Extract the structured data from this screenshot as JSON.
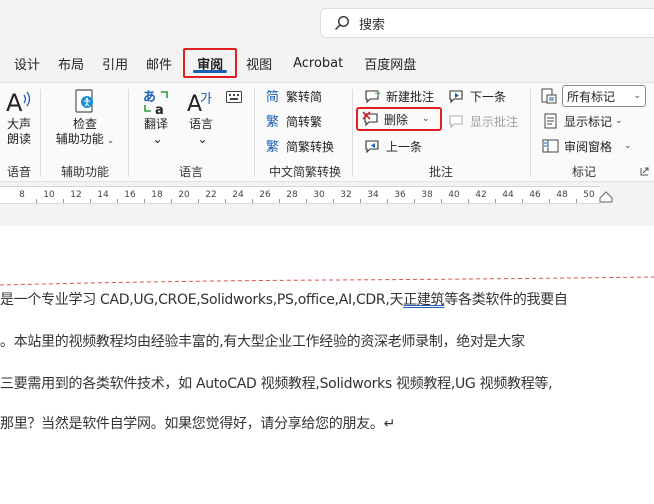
{
  "search": {
    "placeholder": "搜索"
  },
  "tabs": [
    {
      "label": "设计"
    },
    {
      "label": "布局"
    },
    {
      "label": "引用"
    },
    {
      "label": "邮件"
    },
    {
      "label": "审阅",
      "active": true
    },
    {
      "label": "视图"
    },
    {
      "label": "Acrobat"
    },
    {
      "label": "百度网盘"
    }
  ],
  "ribbon": {
    "speech": {
      "line1": "大声",
      "line2": "朗读",
      "group": "语音"
    },
    "accessibility": {
      "line1": "检查",
      "line2": "辅助功能",
      "group": "辅助功能"
    },
    "translate": {
      "label": "翻译"
    },
    "language": {
      "label": "语言",
      "group": "语言"
    },
    "chinese_conv": {
      "to_simplified": "繁转简",
      "to_traditional": "简转繁",
      "conversion": "简繁转换",
      "group": "中文简繁转换"
    },
    "comments": {
      "new": "新建批注",
      "next": "下一条",
      "delete": "删除",
      "show": "显示批注",
      "previous": "上一条",
      "group": "批注"
    },
    "tracking": {
      "markup_select": "所有标记",
      "show_markup": "显示标记",
      "review_pane": "审阅窗格",
      "group": "标记"
    }
  },
  "ruler": {
    "ticks": [
      "8",
      "10",
      "12",
      "14",
      "16",
      "18",
      "20",
      "22",
      "24",
      "26",
      "28",
      "30",
      "32",
      "34",
      "36",
      "38",
      "40",
      "42",
      "44",
      "46",
      "48",
      "50"
    ]
  },
  "document": {
    "line1_a": "是一个专业学习 CAD,UG,CROE,Solidworks,PS,office,AI,CDR,天",
    "line1_b": "正建筑",
    "line1_c": "等各类软件的我要自",
    "line2": "。本站里的视频教程均由经验丰富的,有大型企业工作经验的资深老师录制，绝对是大家",
    "line3": "三要需用到的各类软件技术，如 AutoCAD 视频教程,Solidworks 视频教程,UG 视频教程等,",
    "line4": "那里？当然是软件自学网。如果您觉得好，请分享给您的朋友。↵"
  },
  "colors": {
    "highlight_red": "#e02020",
    "accent_blue": "#1a5fb4"
  }
}
